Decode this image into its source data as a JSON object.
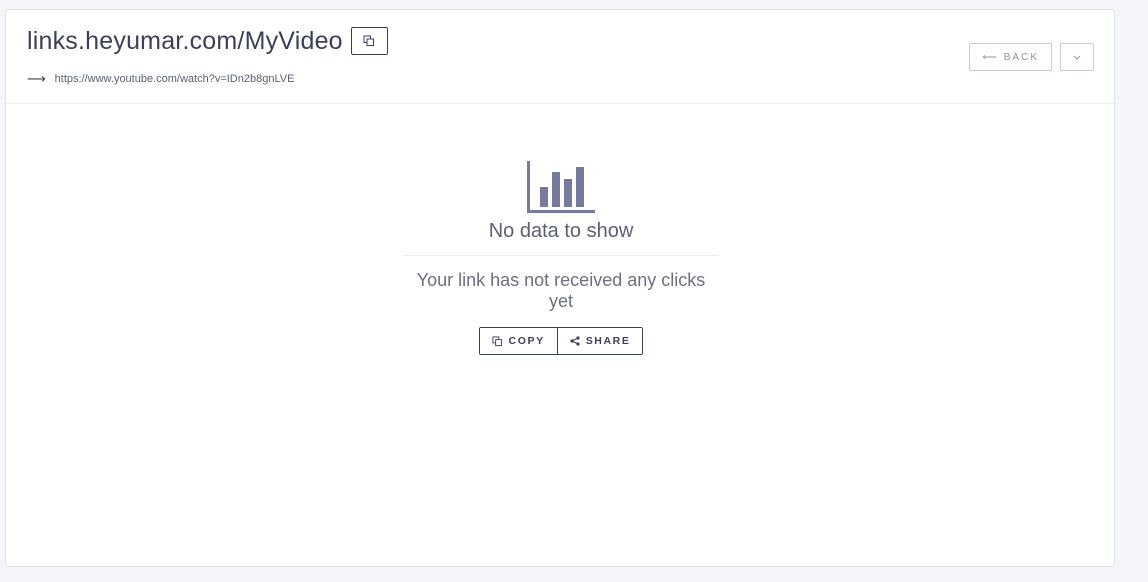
{
  "link": {
    "short_url": "links.heyumar.com/MyVideo",
    "destination_url": "https://www.youtube.com/watch?v=IDn2b8gnLVE"
  },
  "header": {
    "back_label": "BACK"
  },
  "empty_state": {
    "title": "No data to show",
    "subtitle": "Your link has not received any clicks yet",
    "copy_label": "COPY",
    "share_label": "SHARE"
  },
  "colors": {
    "icon": "#777a9f",
    "text": "#3b3f5c"
  }
}
